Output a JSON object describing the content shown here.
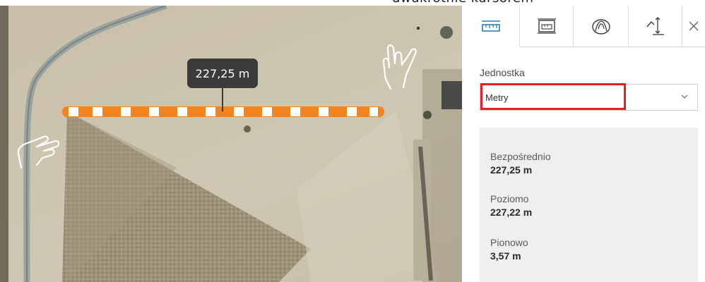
{
  "caption": {
    "text": "dwukrotnie kursorem"
  },
  "map": {
    "measurement_tooltip": "227,25 m"
  },
  "panel": {
    "tabs": [
      {
        "icon": "ruler-distance-icon",
        "active": true
      },
      {
        "icon": "area-measure-icon",
        "active": false
      },
      {
        "icon": "volume-measure-icon",
        "active": false
      },
      {
        "icon": "elevation-profile-icon",
        "active": false
      }
    ],
    "close_icon": "close-icon",
    "unit": {
      "label": "Jednostka",
      "selected": "Metry"
    },
    "results": {
      "direct": {
        "label": "Bezpośrednio",
        "value": "227,25 m"
      },
      "horizontal": {
        "label": "Poziomo",
        "value": "227,22 m"
      },
      "vertical": {
        "label": "Pionowo",
        "value": "3,57 m"
      }
    }
  },
  "colors": {
    "measure_line": "#f2831f",
    "highlight": "#ea1e1e",
    "accent": "#2b7bb9"
  }
}
